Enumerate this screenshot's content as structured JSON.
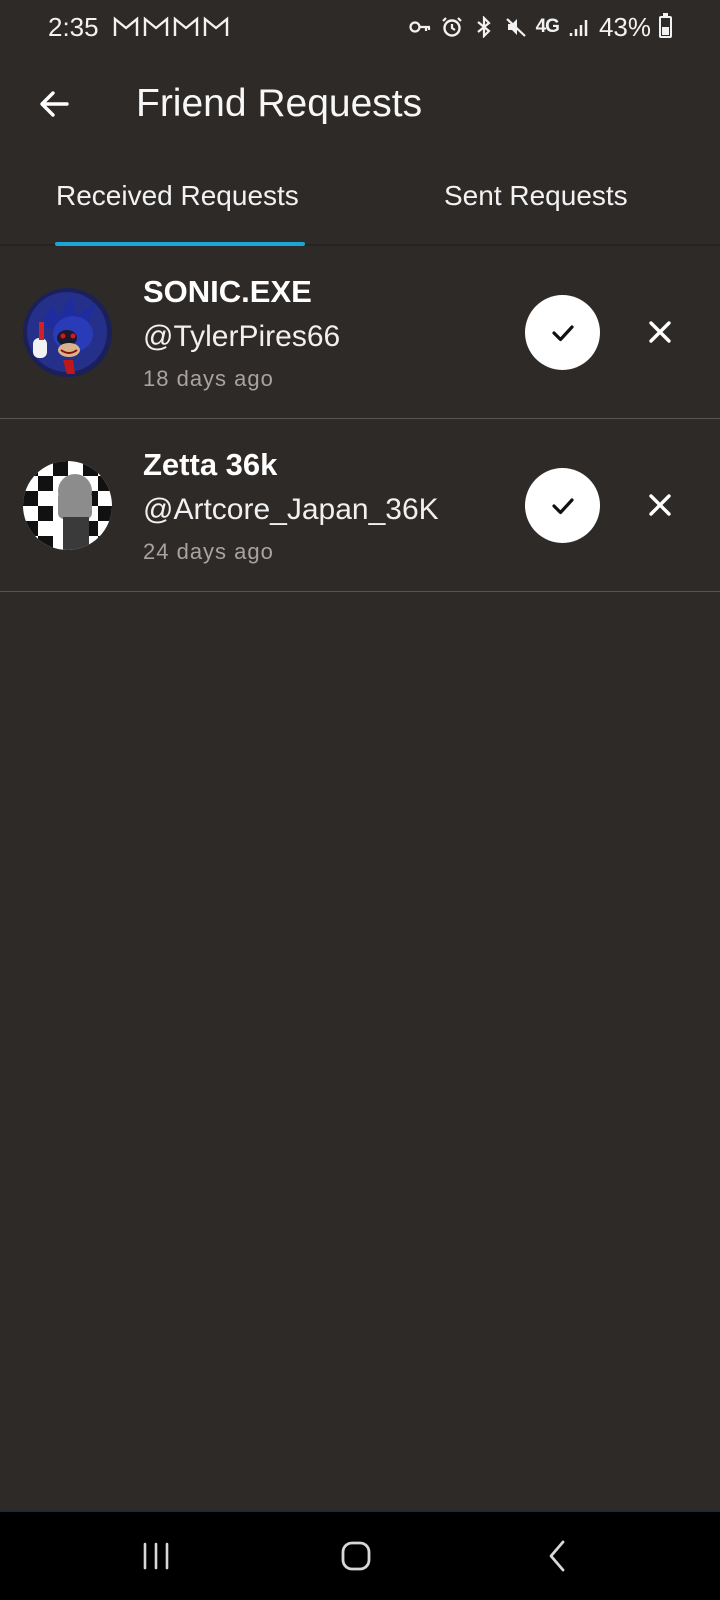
{
  "status_bar": {
    "time": "2:35",
    "network": "4G",
    "battery": "43%",
    "battery_level": 0.43
  },
  "header": {
    "title": "Friend Requests"
  },
  "tabs": [
    {
      "label": "Received Requests",
      "active": true
    },
    {
      "label": "Sent Requests",
      "active": false
    }
  ],
  "requests": [
    {
      "name": "SONIC.EXE",
      "handle": "@TylerPires66",
      "time": "18 days ago"
    },
    {
      "name": "Zetta 36k",
      "handle": "@Artcore_Japan_36K",
      "time": "24 days ago"
    }
  ],
  "colors": {
    "background": "#2e2a28",
    "tab_indicator": "#1aa6d7",
    "secondary_text": "#a8a3a0"
  },
  "icons": {
    "back": "arrow-left-icon",
    "accept": "check-icon",
    "decline": "close-icon",
    "nav_recents": "recents-icon",
    "nav_home": "home-icon",
    "nav_back": "chevron-left-icon"
  }
}
